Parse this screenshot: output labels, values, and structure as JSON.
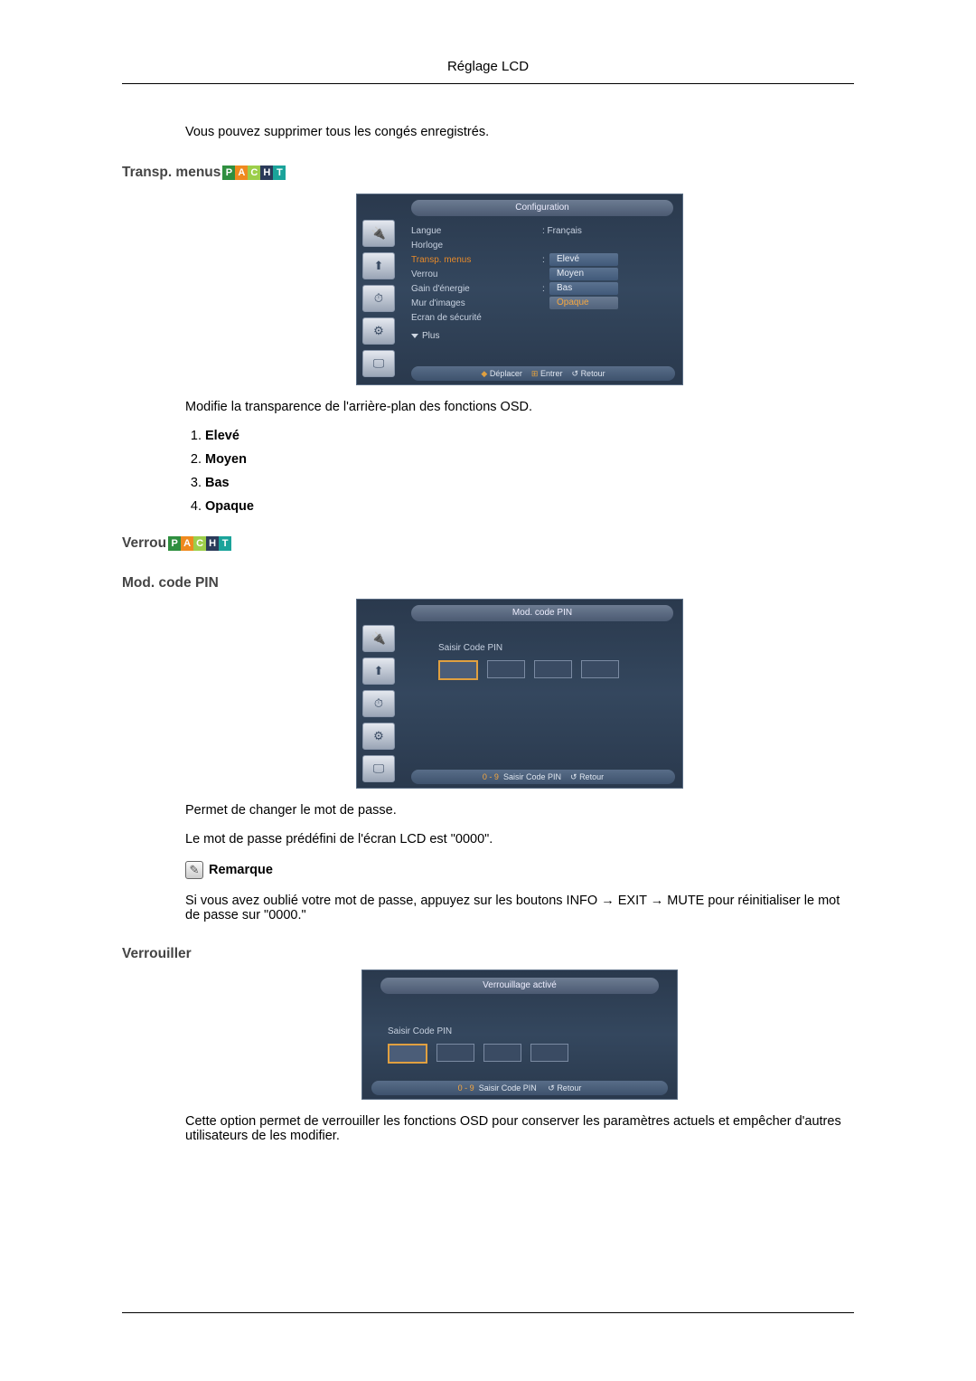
{
  "header": {
    "title": "Réglage LCD"
  },
  "intro": "Vous pouvez supprimer tous les congés enregistrés.",
  "sections": {
    "transp": {
      "title": "Transp. menus",
      "badges": [
        "P",
        "A",
        "C",
        "H",
        "T"
      ],
      "desc": "Modifie la transparence de l'arrière-plan des fonctions OSD.",
      "options": [
        "Elevé",
        "Moyen",
        "Bas",
        "Opaque"
      ]
    },
    "verrou": {
      "title": "Verrou",
      "badges": [
        "P",
        "A",
        "C",
        "H",
        "T"
      ]
    },
    "modpin": {
      "title": "Mod. code PIN",
      "desc1": "Permet de changer le mot de passe.",
      "desc2": "Le mot de passe prédéfini de l'écran LCD est \"0000\".",
      "note_label": "Remarque",
      "note_text": "Si vous avez oublié votre mot de passe, appuyez sur les boutons INFO → EXIT → MUTE pour réinitialiser le mot de passe sur \"0000.\""
    },
    "verrouiller": {
      "title": "Verrouiller",
      "desc": "Cette option permet de verrouiller les fonctions OSD pour conserver les paramètres actuels et empêcher d'autres utilisateurs de les modifier."
    }
  },
  "osd1": {
    "title": "Configuration",
    "rows": {
      "langue": {
        "label": "Langue",
        "value": ": Français"
      },
      "horloge": {
        "label": "Horloge"
      },
      "transp": {
        "label": "Transp. menus",
        "sep": ":"
      },
      "verrou": {
        "label": "Verrou"
      },
      "gain": {
        "label": "Gain d'énergie",
        "sep": ":"
      },
      "mur": {
        "label": "Mur d'images"
      },
      "ecran": {
        "label": "Ecran de sécurité"
      },
      "plus": "Plus"
    },
    "opts": {
      "eleve": "Elevé",
      "moyen": "Moyen",
      "bas": "Bas",
      "opaque": "Opaque"
    },
    "hint": {
      "move": "Déplacer",
      "enter": "Entrer",
      "ret": "Retour"
    }
  },
  "osd2": {
    "title": "Mod. code PIN",
    "label": "Saisir Code PIN",
    "hint": {
      "digits": "0 - 9",
      "enter": "Saisir Code PIN",
      "ret": "Retour"
    }
  },
  "osd3": {
    "title": "Verrouillage activé",
    "label": "Saisir Code PIN",
    "hint": {
      "digits": "0 - 9",
      "enter": "Saisir Code PIN",
      "ret": "Retour"
    }
  },
  "icons": {
    "dot": "◆",
    "btn": "⊞",
    "ret": "↺"
  }
}
